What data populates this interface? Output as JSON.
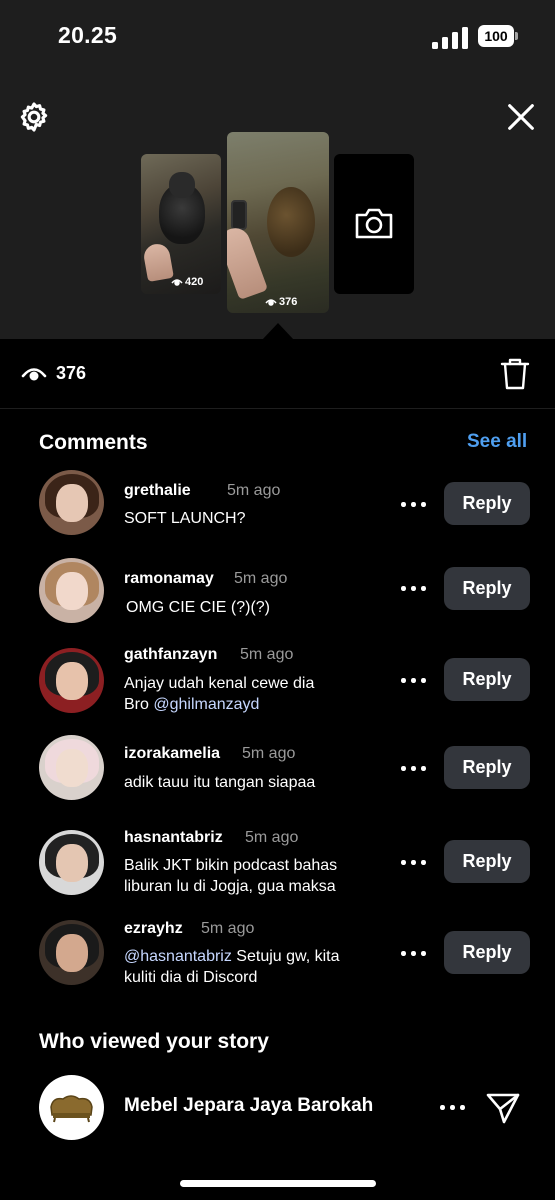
{
  "status_bar": {
    "time": "20.25",
    "battery": "100"
  },
  "icons": {
    "settings": "gear-icon",
    "close": "close-icon",
    "camera": "camera-icon",
    "eye": "eye-icon",
    "trash": "trash-icon",
    "more": "more-icon",
    "send": "send-icon"
  },
  "stories": [
    {
      "views": "420"
    },
    {
      "views": "376"
    }
  ],
  "views_row": {
    "count": "376"
  },
  "comments": {
    "title": "Comments",
    "see_all": "See all",
    "reply_label": "Reply",
    "items": [
      {
        "user": "grethalie",
        "time": "5m ago",
        "text": "SOFT LAUNCH?"
      },
      {
        "user": "ramonamay",
        "time": "5m ago",
        "text": "OMG CIE CIE (?)(?)"
      },
      {
        "user": "gathfanzayn",
        "time": "5m ago",
        "text_line1": "Anjay udah kenal cewe dia",
        "text_line2_prefix": "Bro ",
        "mention": "@ghilmanzayd"
      },
      {
        "user": "izorakamelia",
        "time": "5m ago",
        "text": "adik tauu itu tangan siapaa"
      },
      {
        "user": "hasnantabriz",
        "time": "5m ago",
        "text_line1": "Balik JKT bikin podcast bahas",
        "text_line2": "liburan lu di Jogja, gua maksa"
      },
      {
        "user": "ezrayhz",
        "time": "5m ago",
        "mention": "@hasnantabriz",
        "text_line1_suffix": " Setuju gw, kita",
        "text_line2": "kuliti dia di Discord"
      }
    ]
  },
  "viewers": {
    "title": "Who viewed your story",
    "items": [
      {
        "name": "Mebel Jepara Jaya Barokah"
      }
    ]
  },
  "colors": {
    "accent_link": "#4f9ff0",
    "reply_button": "#33363c",
    "top_panel": "#1e1e1e"
  }
}
